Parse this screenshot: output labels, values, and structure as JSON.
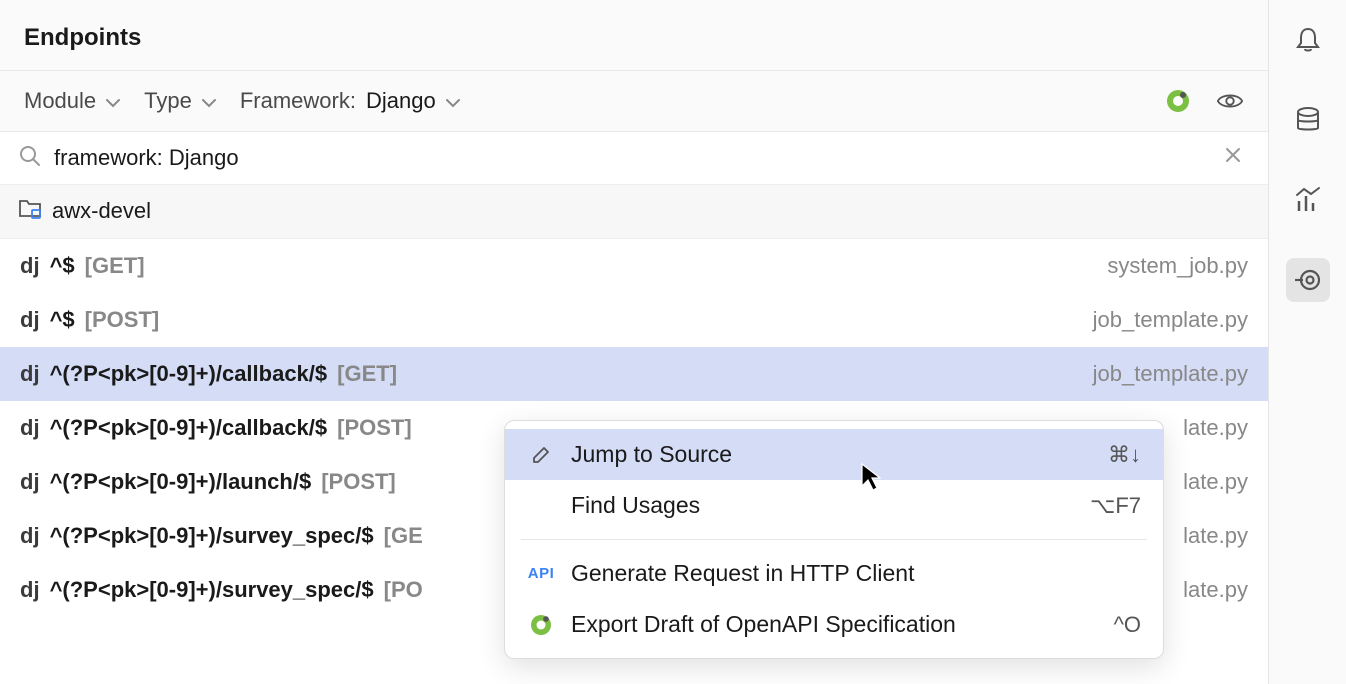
{
  "header": {
    "title": "Endpoints"
  },
  "filters": {
    "module_label": "Module",
    "type_label": "Type",
    "framework_label": "Framework:",
    "framework_value": "Django"
  },
  "search": {
    "value": "framework: Django"
  },
  "project": {
    "name": "awx-devel"
  },
  "endpoints": [
    {
      "badge": "dj",
      "route": "^$",
      "method": "[GET]",
      "file": "system_job.py"
    },
    {
      "badge": "dj",
      "route": "^$",
      "method": "[POST]",
      "file": "job_template.py"
    },
    {
      "badge": "dj",
      "route": "^(?P<pk>[0-9]+)/callback/$",
      "method": "[GET]",
      "file": "job_template.py"
    },
    {
      "badge": "dj",
      "route": "^(?P<pk>[0-9]+)/callback/$",
      "method": "[POST]",
      "file": "late.py"
    },
    {
      "badge": "dj",
      "route": "^(?P<pk>[0-9]+)/launch/$",
      "method": "[POST]",
      "file": "late.py"
    },
    {
      "badge": "dj",
      "route": "^(?P<pk>[0-9]+)/survey_spec/$",
      "method": "[GE",
      "file": "late.py"
    },
    {
      "badge": "dj",
      "route": "^(?P<pk>[0-9]+)/survey_spec/$",
      "method": "[PO",
      "file": "late.py"
    }
  ],
  "context_menu": {
    "items": [
      {
        "icon": "pencil",
        "label": "Jump to Source",
        "shortcut": "⌘↓"
      },
      {
        "icon": "",
        "label": "Find Usages",
        "shortcut": "⌥F7"
      }
    ],
    "items2": [
      {
        "icon": "api",
        "label": "Generate Request in HTTP Client",
        "shortcut": ""
      },
      {
        "icon": "openapi",
        "label": "Export Draft of OpenAPI Specification",
        "shortcut": "^O"
      }
    ]
  }
}
